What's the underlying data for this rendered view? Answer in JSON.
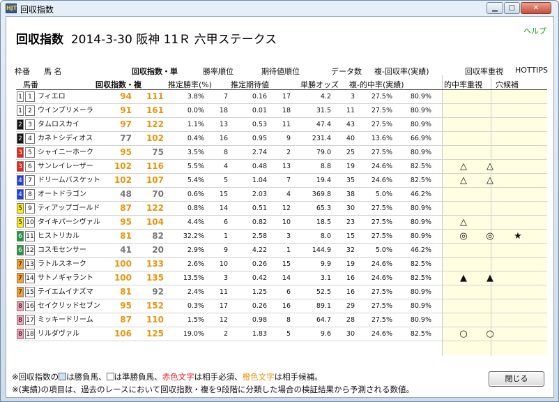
{
  "window": {
    "title": "回収指数",
    "app_icon": "HJT"
  },
  "header": {
    "help": "ヘルプ",
    "race_title": "回収指数",
    "race_date": "2014-3-30",
    "race_name": "阪神 11Ｒ 六甲ステークス"
  },
  "columns": {
    "waku": "枠番",
    "uma_name": "馬 名",
    "umaban": "馬番",
    "tan_index": "回収指数・単",
    "fuku_index": "回収指数・複",
    "suitei": "推定勝率(%)",
    "shoritsu_rank": "勝率順位",
    "kitai": "推定期待値",
    "kitai_rank": "期待値順位",
    "odds": "単勝オッズ",
    "data_count": "データ数",
    "tekichu": "複-的中率(実績)",
    "kaishu": "複-回収率(実績)",
    "kaishu_juushi": "回収率重視",
    "hottips": "HOTTIPS",
    "tekichu_juushi": "的中率重視",
    "ana": "穴候補"
  },
  "rows": [
    {
      "waku": "1",
      "umaban": "1",
      "name": "フィエロ",
      "tan": "94",
      "fuku": "111",
      "tan_color": "#e8960c",
      "fuku_color": "#e8960c",
      "suitei": "3.8%",
      "sr": "7",
      "kitai": "0.16",
      "kr": "17",
      "odds": "4.2",
      "n": "3",
      "hit": "27.5%",
      "ret": "80.9%",
      "m1": "",
      "m2": "",
      "m3": ""
    },
    {
      "waku": "1",
      "umaban": "2",
      "name": "ウインプリメーラ",
      "tan": "91",
      "fuku": "161",
      "tan_color": "#e8960c",
      "fuku_color": "#e8960c",
      "suitei": "0.0%",
      "sr": "18",
      "kitai": "0.01",
      "kr": "18",
      "odds": "31.5",
      "n": "11",
      "hit": "27.5%",
      "ret": "80.9%",
      "m1": "",
      "m2": "",
      "m3": ""
    },
    {
      "waku": "2",
      "umaban": "3",
      "name": "タムロスカイ",
      "tan": "97",
      "fuku": "122",
      "tan_color": "#e8960c",
      "fuku_color": "#e8960c",
      "suitei": "1.1%",
      "sr": "13",
      "kitai": "0.53",
      "kr": "11",
      "odds": "47.4",
      "n": "43",
      "hit": "27.5%",
      "ret": "80.9%",
      "m1": "",
      "m2": "",
      "m3": ""
    },
    {
      "waku": "2",
      "umaban": "4",
      "name": "カネトシディオス",
      "tan": "77",
      "fuku": "102",
      "tan_color": "#777777",
      "fuku_color": "#e8960c",
      "suitei": "0.4%",
      "sr": "16",
      "kitai": "0.95",
      "kr": "9",
      "odds": "231.4",
      "n": "40",
      "hit": "13.6%",
      "ret": "66.9%",
      "m1": "",
      "m2": "",
      "m3": ""
    },
    {
      "waku": "3",
      "umaban": "5",
      "name": "シャイニーホーク",
      "tan": "95",
      "fuku": "75",
      "tan_color": "#e8960c",
      "fuku_color": "#777777",
      "suitei": "3.5%",
      "sr": "8",
      "kitai": "2.74",
      "kr": "2",
      "odds": "79.0",
      "n": "25",
      "hit": "27.5%",
      "ret": "80.9%",
      "m1": "",
      "m2": "",
      "m3": ""
    },
    {
      "waku": "3",
      "umaban": "6",
      "name": "サンレイレーザー",
      "tan": "102",
      "fuku": "116",
      "tan_color": "#e8960c",
      "fuku_color": "#e8960c",
      "suitei": "5.5%",
      "sr": "4",
      "kitai": "0.48",
      "kr": "13",
      "odds": "8.8",
      "n": "19",
      "hit": "24.6%",
      "ret": "82.5%",
      "m1": "△",
      "m2": "△",
      "m3": ""
    },
    {
      "waku": "4",
      "umaban": "7",
      "name": "ドリームバスケット",
      "tan": "102",
      "fuku": "107",
      "tan_color": "#e8960c",
      "fuku_color": "#e8960c",
      "suitei": "5.4%",
      "sr": "5",
      "kitai": "1.04",
      "kr": "7",
      "odds": "19.4",
      "n": "35",
      "hit": "24.6%",
      "ret": "82.5%",
      "m1": "△",
      "m2": "△",
      "m3": ""
    },
    {
      "waku": "4",
      "umaban": "8",
      "name": "オートドラゴン",
      "tan": "48",
      "fuku": "70",
      "tan_color": "#777777",
      "fuku_color": "#777777",
      "suitei": "0.6%",
      "sr": "15",
      "kitai": "2.03",
      "kr": "4",
      "odds": "369.8",
      "n": "38",
      "hit": "5.0%",
      "ret": "46.2%",
      "m1": "",
      "m2": "",
      "m3": ""
    },
    {
      "waku": "5",
      "umaban": "9",
      "name": "ティアップゴールド",
      "tan": "87",
      "fuku": "122",
      "tan_color": "#e8960c",
      "fuku_color": "#e8960c",
      "suitei": "0.8%",
      "sr": "14",
      "kitai": "0.51",
      "kr": "12",
      "odds": "65.3",
      "n": "30",
      "hit": "27.5%",
      "ret": "80.9%",
      "m1": "",
      "m2": "",
      "m3": ""
    },
    {
      "waku": "5",
      "umaban": "10",
      "name": "タイキパーシヴァル",
      "tan": "95",
      "fuku": "104",
      "tan_color": "#e8960c",
      "fuku_color": "#e8960c",
      "suitei": "4.4%",
      "sr": "6",
      "kitai": "0.82",
      "kr": "10",
      "odds": "18.5",
      "n": "23",
      "hit": "27.5%",
      "ret": "80.9%",
      "m1": "△",
      "m2": "",
      "m3": ""
    },
    {
      "waku": "6",
      "umaban": "11",
      "name": "ヒストリカル",
      "tan": "81",
      "fuku": "82",
      "tan_color": "#e8960c",
      "fuku_color": "#777777",
      "suitei": "32.2%",
      "sr": "1",
      "kitai": "2.58",
      "kr": "3",
      "odds": "8.0",
      "n": "15",
      "hit": "27.5%",
      "ret": "80.9%",
      "m1": "◎",
      "m2": "◎",
      "m3": "★"
    },
    {
      "waku": "6",
      "umaban": "12",
      "name": "コスモセンサー",
      "tan": "41",
      "fuku": "20",
      "tan_color": "#777777",
      "fuku_color": "#777777",
      "suitei": "2.9%",
      "sr": "9",
      "kitai": "4.22",
      "kr": "1",
      "odds": "144.9",
      "n": "32",
      "hit": "5.0%",
      "ret": "46.2%",
      "m1": "",
      "m2": "",
      "m3": ""
    },
    {
      "waku": "7",
      "umaban": "13",
      "name": "ラトルスネーク",
      "tan": "100",
      "fuku": "133",
      "tan_color": "#e8960c",
      "fuku_color": "#e8960c",
      "suitei": "2.6%",
      "sr": "10",
      "kitai": "0.26",
      "kr": "15",
      "odds": "9.9",
      "n": "19",
      "hit": "24.6%",
      "ret": "82.5%",
      "m1": "",
      "m2": "",
      "m3": ""
    },
    {
      "waku": "7",
      "umaban": "14",
      "name": "サトノギャラント",
      "tan": "100",
      "fuku": "135",
      "tan_color": "#e8960c",
      "fuku_color": "#e8960c",
      "suitei": "13.5%",
      "sr": "3",
      "kitai": "0.42",
      "kr": "14",
      "odds": "3.1",
      "n": "16",
      "hit": "24.6%",
      "ret": "82.5%",
      "m1": "▲",
      "m2": "▲",
      "m3": ""
    },
    {
      "waku": "7",
      "umaban": "15",
      "name": "テイエムイナズマ",
      "tan": "81",
      "fuku": "92",
      "tan_color": "#e8960c",
      "fuku_color": "#777777",
      "suitei": "2.4%",
      "sr": "11",
      "kitai": "1.25",
      "kr": "6",
      "odds": "52.5",
      "n": "16",
      "hit": "27.5%",
      "ret": "80.9%",
      "m1": "",
      "m2": "",
      "m3": ""
    },
    {
      "waku": "8",
      "umaban": "16",
      "name": "セイクリッドセブン",
      "tan": "95",
      "fuku": "152",
      "tan_color": "#e8960c",
      "fuku_color": "#e8960c",
      "suitei": "0.3%",
      "sr": "17",
      "kitai": "0.26",
      "kr": "16",
      "odds": "89.1",
      "n": "29",
      "hit": "27.5%",
      "ret": "80.9%",
      "m1": "",
      "m2": "",
      "m3": ""
    },
    {
      "waku": "8",
      "umaban": "17",
      "name": "ミッキードリーム",
      "tan": "87",
      "fuku": "110",
      "tan_color": "#e8960c",
      "fuku_color": "#e8960c",
      "suitei": "1.5%",
      "sr": "12",
      "kitai": "0.98",
      "kr": "8",
      "odds": "64.7",
      "n": "28",
      "hit": "27.5%",
      "ret": "80.9%",
      "m1": "",
      "m2": "",
      "m3": ""
    },
    {
      "waku": "8",
      "umaban": "18",
      "name": "リルダヴァル",
      "tan": "106",
      "fuku": "125",
      "tan_color": "#e8960c",
      "fuku_color": "#e8960c",
      "suitei": "19.0%",
      "sr": "2",
      "kitai": "1.83",
      "kr": "5",
      "odds": "9.6",
      "n": "30",
      "hit": "24.6%",
      "ret": "82.5%",
      "m1": "○",
      "m2": "○",
      "m3": ""
    }
  ],
  "waku_colors": {
    "1": {
      "bg": "#ffffff",
      "fg": "#000000"
    },
    "2": {
      "bg": "#111111",
      "fg": "#ffffff"
    },
    "3": {
      "bg": "#e8241c",
      "fg": "#ffffff"
    },
    "4": {
      "bg": "#1c3fe8",
      "fg": "#ffffff"
    },
    "5": {
      "bg": "#ffee00",
      "fg": "#000000"
    },
    "6": {
      "bg": "#1e9a3c",
      "fg": "#ffffff"
    },
    "7": {
      "bg": "#f5a020",
      "fg": "#000000"
    },
    "8": {
      "bg": "#f5a0b4",
      "fg": "#000000"
    }
  },
  "footer": {
    "line1_a": "※回収指数の",
    "line1_b": "は勝負馬、",
    "line1_c": "は準勝負馬、",
    "line1_red": "赤色文字",
    "line1_d": "は相手必須、",
    "line1_orange": "橙色文字",
    "line1_e": "は相手候補。",
    "line2": "※(実績)の項目は、過去のレースにおいて回収指数・複を9段階に分類した場合の検証結果から予測される数値。",
    "close_button": "閉じる"
  },
  "colors": {
    "accent_orange": "#e8960c",
    "red_text": "#e02020",
    "help_green": "#14a014",
    "highlight_blue": "#c8e4f8"
  }
}
